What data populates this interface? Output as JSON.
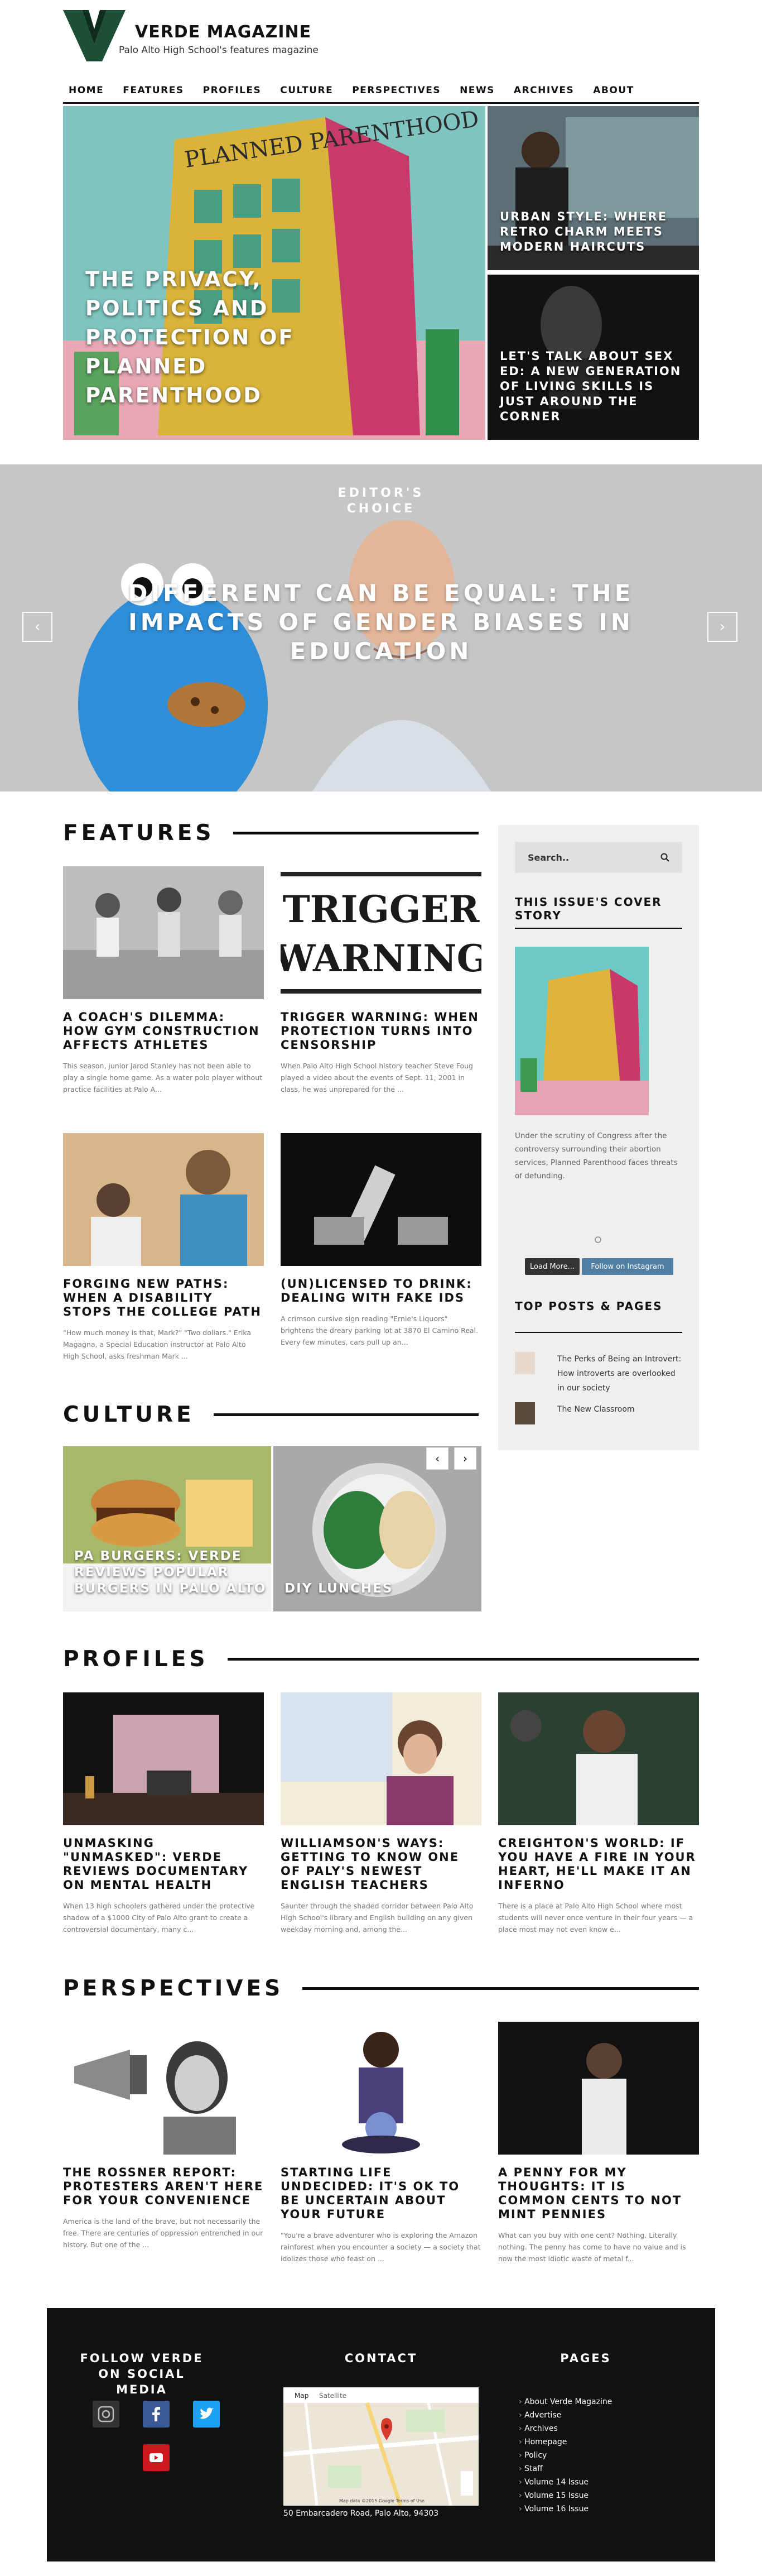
{
  "site": {
    "title": "VERDE MAGAZINE",
    "subtitle": "Palo Alto High School's features magazine"
  },
  "nav": [
    "HOME",
    "FEATURES",
    "PROFILES",
    "CULTURE",
    "PERSPECTIVES",
    "NEWS",
    "ARCHIVES",
    "ABOUT"
  ],
  "hero": {
    "main_title": "THE PRIVACY, POLITICS AND PROTECTION OF PLANNED PARENTHOOD",
    "side_top_title": "URBAN STYLE: WHERE RETRO CHARM MEETS MODERN HAIRCUTS",
    "side_bottom_title": "LET'S TALK ABOUT SEX ED: A NEW GENERATION OF LIVING SKILLS IS JUST AROUND THE CORNER",
    "poster_text": "PLANNED PARENTHOOD"
  },
  "slider": {
    "label": "EDITOR'S CHOICE",
    "title": "DIFFERENT CAN BE EQUAL: THE IMPACTS OF GENDER BIASES IN EDUCATION",
    "prev": "‹",
    "next": "›"
  },
  "features": {
    "heading": "FEATURES",
    "cards": [
      {
        "title": "A COACH'S DILEMMA: HOW GYM CONSTRUCTION AFFECTS ATHLETES",
        "excerpt": "This season, junior Jarod Stanley has not been able to play a single home game. As a water polo player without practice facilities at Palo A..."
      },
      {
        "title": "TRIGGER WARNING: WHEN PROTECTION TURNS INTO CENSORSHIP",
        "excerpt": "When Palo Alto High School history teacher Steve Foug played a video about the events of Sept. 11, 2001 in class, he was unprepared for the ...",
        "img_text_1": "TRIGGER",
        "img_text_2": "WARNING"
      },
      {
        "title": "FORGING NEW PATHS: WHEN A DISABILITY STOPS THE COLLEGE PATH",
        "excerpt": "\"How much money is that, Mark?\" \"Two dollars.\" Erika Magagna, a Special Education instructor at Palo Alto High School, asks freshman Mark ..."
      },
      {
        "title": "(UN)LICENSED TO DRINK: DEALING WITH FAKE IDS",
        "excerpt": "A crimson cursive sign reading \"Ernie's Liquors\" brightens the dreary parking lot at 3870 El Camino Real. Every few minutes, cars pull up an..."
      }
    ]
  },
  "sidebar": {
    "search_placeholder": "Search..",
    "cover_heading": "THIS ISSUE'S COVER STORY",
    "cover_text": "Under the scrutiny of Congress after the controversy surrounding their abortion services, Planned Parenthood faces threats of defunding.",
    "load_more": "Load More...",
    "follow_instagram": "Follow on Instagram",
    "top_heading": "TOP POSTS & PAGES",
    "top_posts": [
      "The Perks of Being an Introvert: How introverts are overlooked in our society",
      "The New Classroom"
    ]
  },
  "culture": {
    "heading": "CULTURE",
    "cards": [
      {
        "title": "PA BURGERS: VERDE REVIEWS POPULAR BURGERS IN PALO ALTO"
      },
      {
        "title": "DIY LUNCHES"
      }
    ],
    "prev": "‹",
    "next": "›"
  },
  "profiles": {
    "heading": "PROFILES",
    "cards": [
      {
        "title": "UNMASKING \"UNMASKED\": VERDE REVIEWS DOCUMENTARY ON MENTAL HEALTH",
        "excerpt": "When 13 high schoolers gathered under the protective shadow of a $1000 City of Palo Alto grant to create a controversial documentary, many c..."
      },
      {
        "title": "WILLIAMSON'S WAYS: GETTING TO KNOW ONE OF PALY'S NEWEST ENGLISH TEACHERS",
        "excerpt": "Saunter through the shaded corridor between Palo Alto High School's library and English building on any given weekday morning and, among the..."
      },
      {
        "title": "CREIGHTON'S WORLD: IF YOU HAVE A FIRE IN YOUR HEART, HE'LL MAKE IT AN INFERNO",
        "excerpt": "There is a place at Palo Alto High School where most students will never once venture in their four years — a place most may not even know e..."
      }
    ]
  },
  "perspectives": {
    "heading": "PERSPECTIVES",
    "cards": [
      {
        "title": "THE ROSSNER REPORT: PROTESTERS AREN'T HERE FOR YOUR CONVENIENCE",
        "excerpt": "America is the land of the brave, but not necessarily the free. There are centuries of oppression entrenched in our history. But one of the ..."
      },
      {
        "title": "STARTING LIFE UNDECIDED: IT'S OK TO BE UNCERTAIN ABOUT YOUR FUTURE",
        "excerpt": "\"You're a brave adventurer who is exploring the Amazon rainforest when you encounter a society — a society that idolizes those who feast on ..."
      },
      {
        "title": "A PENNY FOR MY THOUGHTS: IT IS COMMON CENTS TO NOT MINT PENNIES",
        "excerpt": "What can you buy with one cent? Nothing. Literally nothing. The penny has come to have no value and is now the most idiotic waste of metal f..."
      }
    ]
  },
  "footer": {
    "follow_heading": "FOLLOW VERDE ON SOCIAL MEDIA",
    "contact_heading": "CONTACT",
    "pages_heading": "PAGES",
    "address": "50 Embarcadero Road, Palo Alto, 94303",
    "map_tab_map": "Map",
    "map_tab_sat": "Satellite",
    "map_credit": "Map data ©2015 Google  Terms of Use",
    "pages": [
      "About Verde Magazine",
      "Advertise",
      "Archives",
      "Homepage",
      "Policy",
      "Staff",
      "Volume 14 Issue",
      "Volume 15 Issue",
      "Volume 16 Issue"
    ],
    "colors": {
      "facebook": "#3b5998",
      "twitter": "#1da1f2",
      "youtube": "#cc181e",
      "instagram": "#333333"
    }
  }
}
